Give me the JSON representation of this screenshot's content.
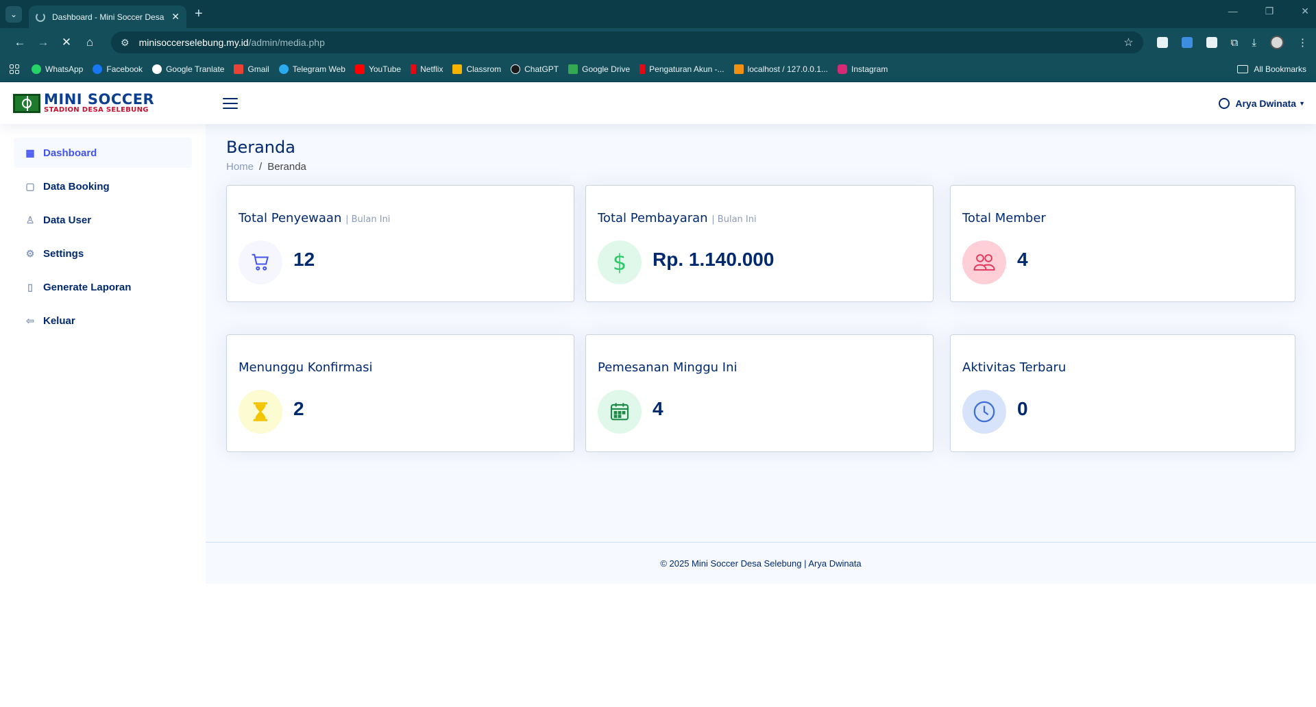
{
  "browser": {
    "tab_title": "Dashboard - Mini Soccer Desa S",
    "url_host": "minisoccerselebung.my.id",
    "url_path": "/admin/media.php",
    "bookmarks": [
      "WhatsApp",
      "Facebook",
      "Google Tranlate",
      "Gmail",
      "Telegram Web",
      "YouTube",
      "Netflix",
      "Classrom",
      "ChatGPT",
      "Google Drive",
      "Pengaturan Akun -...",
      "localhost / 127.0.0.1...",
      "Instagram"
    ],
    "all_bookmarks": "All Bookmarks"
  },
  "header": {
    "logo_line1": "MINI SOCCER",
    "logo_line2": "STADION DESA SELEBUNG",
    "user_name": "Arya Dwinata"
  },
  "sidebar": {
    "items": [
      {
        "label": "Dashboard",
        "icon": "grid-icon"
      },
      {
        "label": "Data Booking",
        "icon": "bag-icon"
      },
      {
        "label": "Data User",
        "icon": "person-icon"
      },
      {
        "label": "Settings",
        "icon": "gear-icon"
      },
      {
        "label": "Generate Laporan",
        "icon": "document-icon"
      },
      {
        "label": "Keluar",
        "icon": "logout-icon"
      }
    ]
  },
  "page": {
    "title": "Beranda",
    "breadcrumb_home": "Home",
    "breadcrumb_current": "Beranda"
  },
  "cards": [
    {
      "title": "Total Penyewaan",
      "sub": "| Bulan Ini",
      "value": "12",
      "icon": "cart-icon",
      "color": "#4154f1",
      "bg": "#f6f6fe"
    },
    {
      "title": "Total Pembayaran",
      "sub": "| Bulan Ini",
      "value": "Rp. 1.140.000",
      "icon": "dollar-icon",
      "color": "#2eca6a",
      "bg": "#e0f8e9"
    },
    {
      "title": "Total Member",
      "sub": "",
      "value": "4",
      "icon": "people-icon",
      "color": "#e4365a",
      "bg": "#ffcfd7"
    },
    {
      "title": "Menunggu Konfirmasi",
      "sub": "",
      "value": "2",
      "icon": "hourglass-icon",
      "color": "#f2c500",
      "bg": "#fdfbd2"
    },
    {
      "title": "Pemesanan Minggu Ini",
      "sub": "",
      "value": "4",
      "icon": "calendar-icon",
      "color": "#1e8a47",
      "bg": "#e0f8e9"
    },
    {
      "title": "Aktivitas Terbaru",
      "sub": "",
      "value": "0",
      "icon": "clock-icon",
      "color": "#3e6fd6",
      "bg": "#d6e3fa"
    }
  ],
  "footer": {
    "text": "© 2025 Mini Soccer Desa Selebung | Arya Dwinata"
  }
}
